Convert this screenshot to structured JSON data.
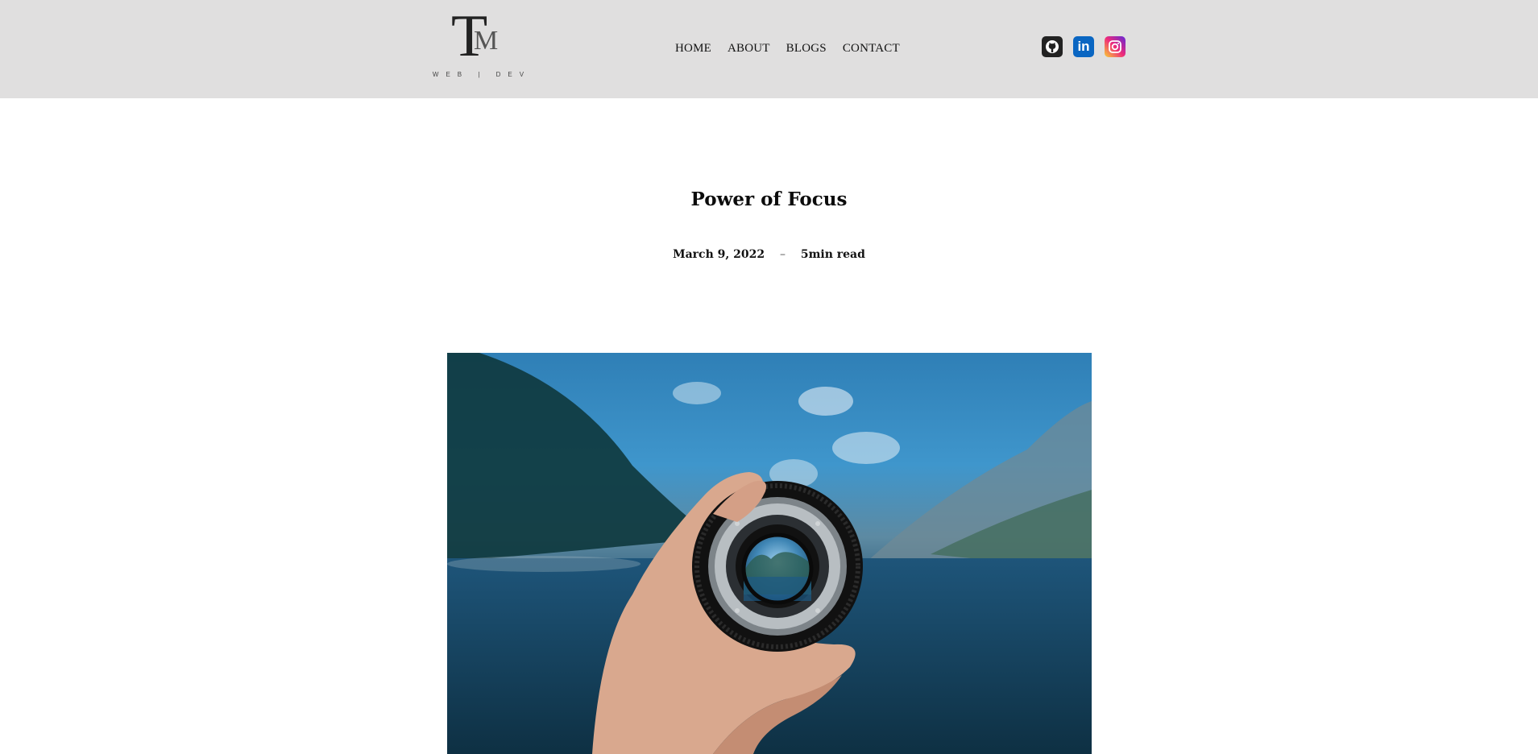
{
  "logo": {
    "main_T": "T",
    "main_M": "M",
    "subtitle": "WEB | DEV"
  },
  "nav": {
    "items": [
      "HOME",
      "ABOUT",
      "BLOGS",
      "CONTACT"
    ]
  },
  "social": {
    "icons": [
      "github-icon",
      "linkedin-icon",
      "instagram-icon"
    ],
    "linkedin_text": "in"
  },
  "post": {
    "title": "Power of Focus",
    "date": "March 9, 2022",
    "separator": "–",
    "read_time": "5min read"
  },
  "colors": {
    "header_bg": "#e0dfdf",
    "linkedin": "#0a66c2",
    "github": "#222222"
  }
}
